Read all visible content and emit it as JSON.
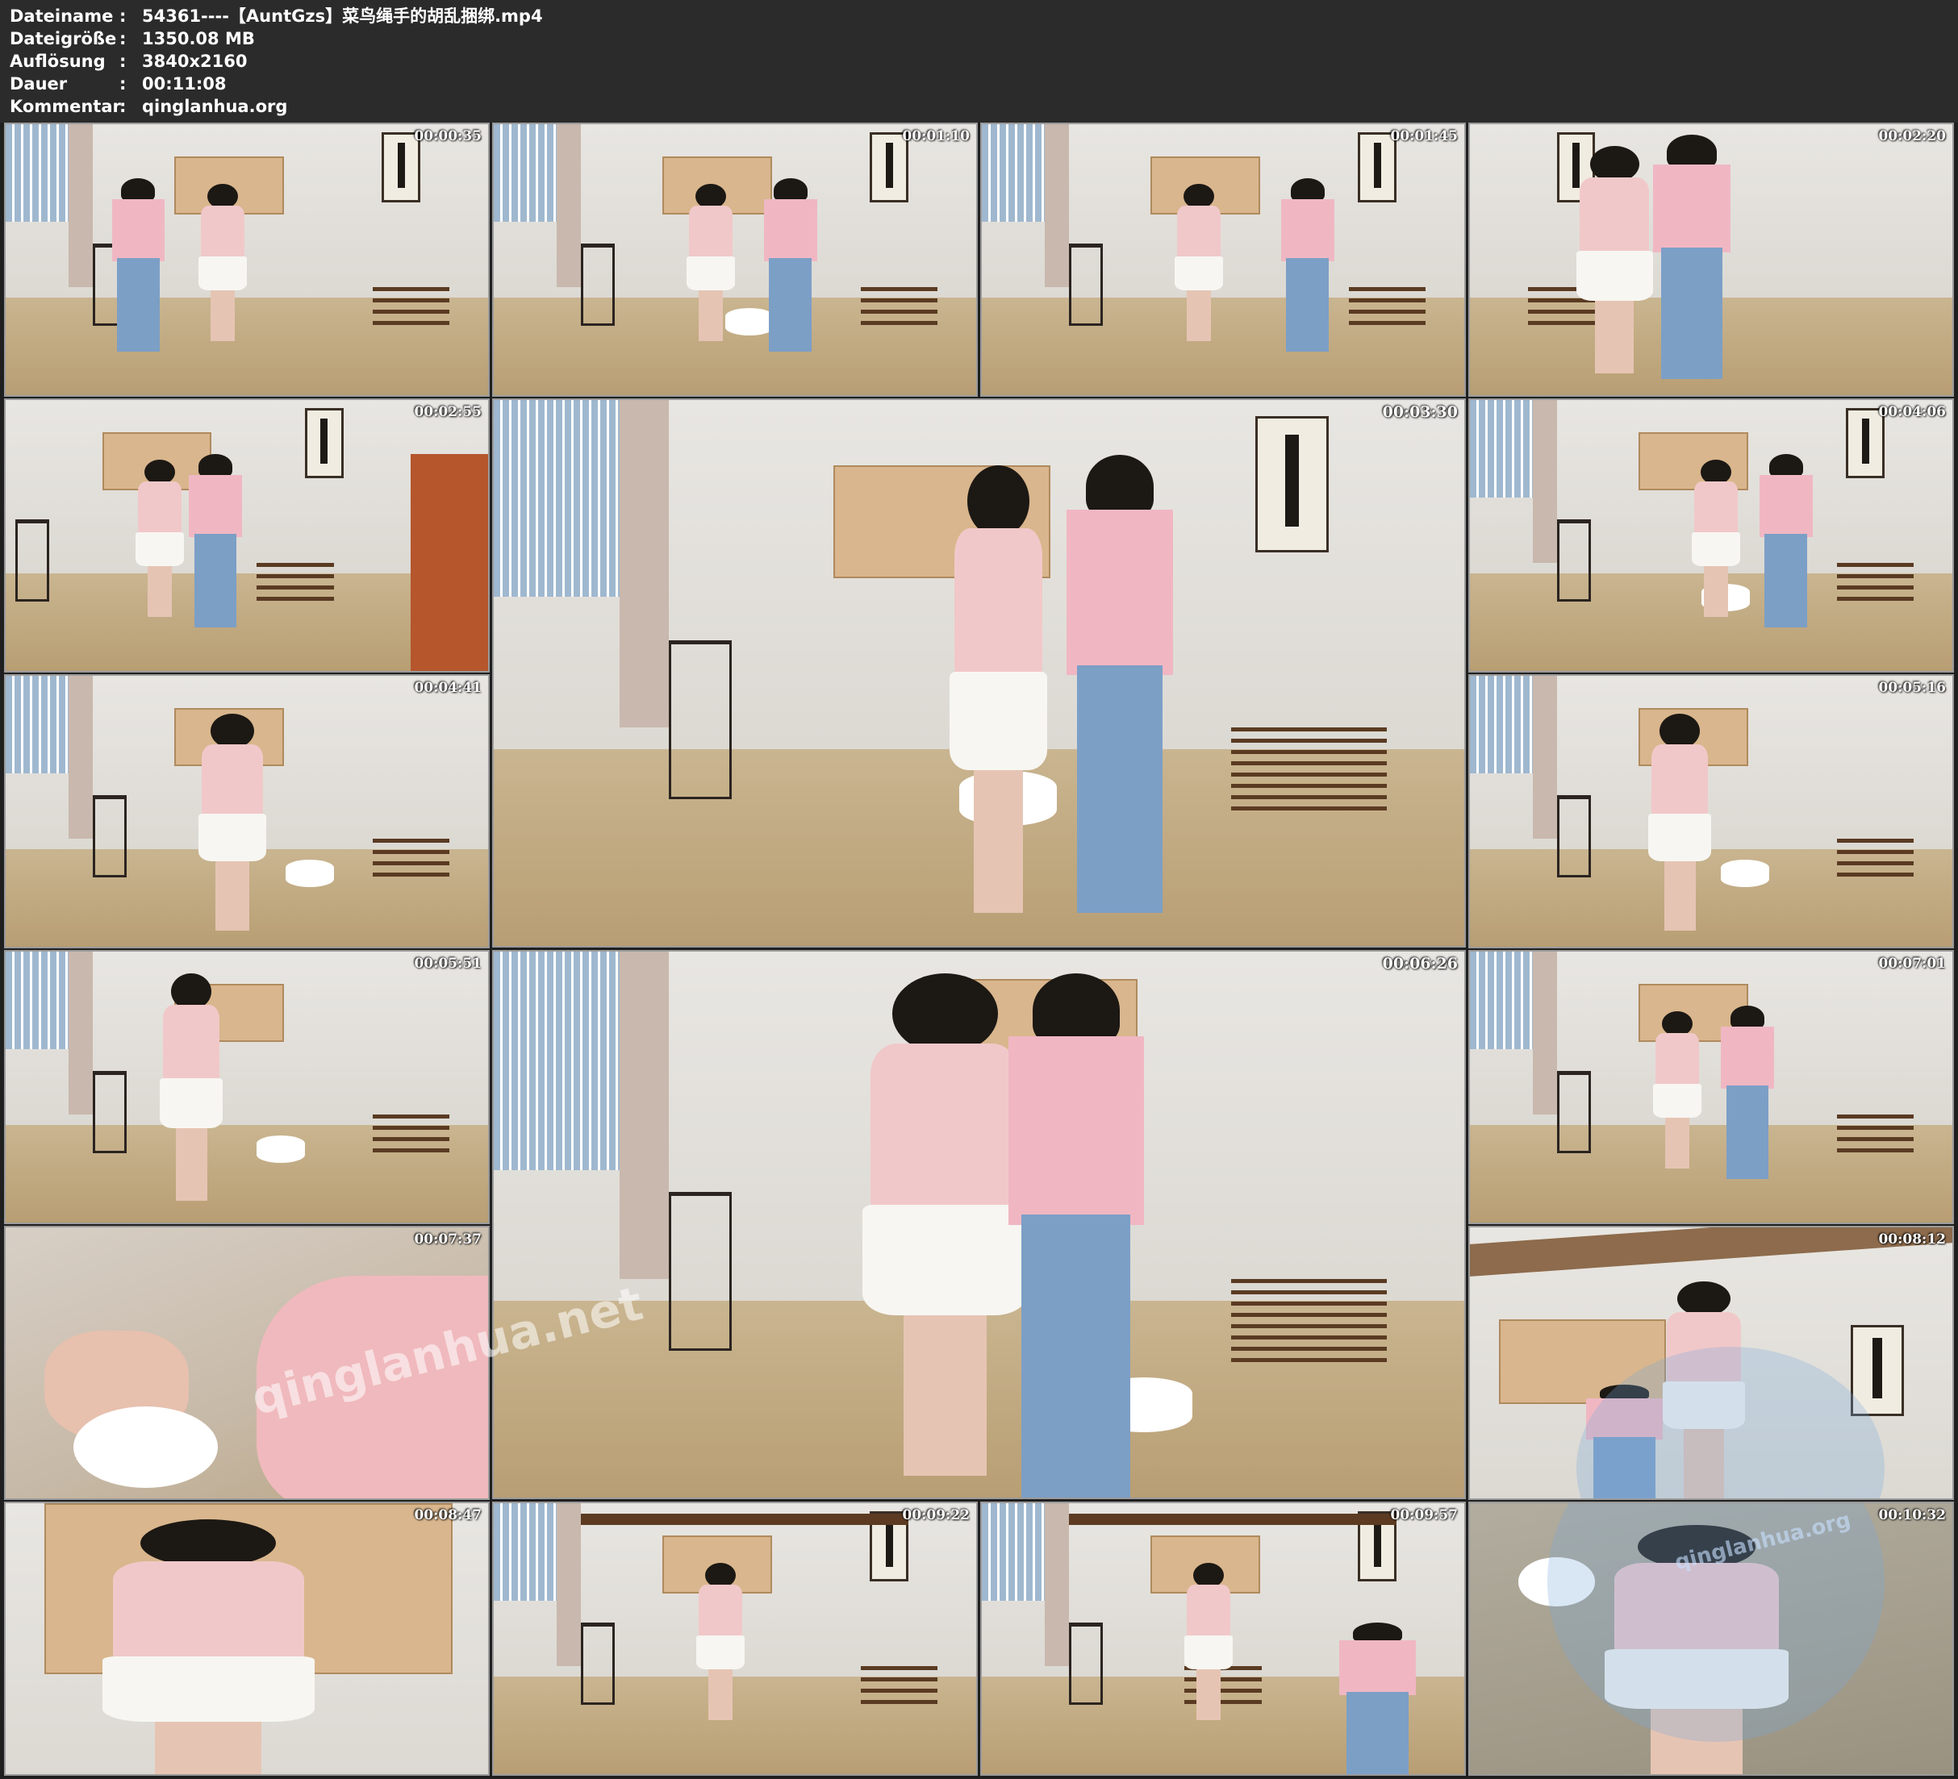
{
  "header": {
    "rows": [
      {
        "key": "Dateiname",
        "sep": ":",
        "value": "54361----【AuntGzs】菜鸟绳手的胡乱捆绑.mp4"
      },
      {
        "key": "Dateigröße",
        "sep": ":",
        "value": "1350.08 MB"
      },
      {
        "key": "Auflösung",
        "sep": ":",
        "value": "3840x2160"
      },
      {
        "key": "Dauer",
        "sep": ":",
        "value": "00:11:08"
      },
      {
        "key": "Kommentar",
        "sep": ":",
        "value": "qinglanhua.org"
      }
    ]
  },
  "thumbnails": [
    {
      "timestamp": "00:00:35"
    },
    {
      "timestamp": "00:01:10"
    },
    {
      "timestamp": "00:01:45"
    },
    {
      "timestamp": "00:02:20"
    },
    {
      "timestamp": "00:02:55"
    },
    {
      "timestamp": "00:03:30"
    },
    {
      "timestamp": "00:04:06"
    },
    {
      "timestamp": "00:04:41"
    },
    {
      "timestamp": "00:05:16"
    },
    {
      "timestamp": "00:05:51"
    },
    {
      "timestamp": "00:06:26"
    },
    {
      "timestamp": "00:07:01"
    },
    {
      "timestamp": "00:07:37"
    },
    {
      "timestamp": "00:08:12"
    },
    {
      "timestamp": "00:08:47"
    },
    {
      "timestamp": "00:09:22"
    },
    {
      "timestamp": "00:09:57"
    },
    {
      "timestamp": "00:10:32"
    }
  ],
  "watermarks": {
    "main": "qinglanhua.net",
    "corner": "qinglanhua.org"
  }
}
